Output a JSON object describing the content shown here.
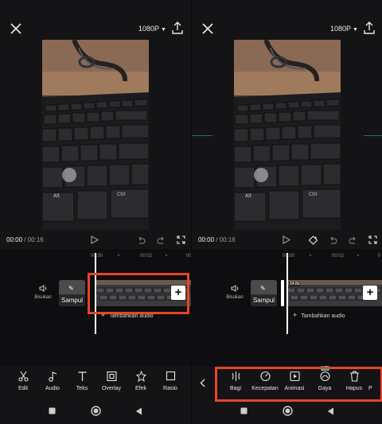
{
  "left": {
    "resolution": "1080P",
    "time_current": "00:00",
    "time_total": "/ 00:16",
    "ruler": [
      "00:00",
      "00:02",
      "00"
    ],
    "mute_label": "Bisukan",
    "cover_label": "Sampul",
    "add_audio_label": "Tambahkan audio",
    "tools": [
      {
        "label": "Edit",
        "icon": "scissors-icon"
      },
      {
        "label": "Audio",
        "icon": "music-note-icon"
      },
      {
        "label": "Teks",
        "icon": "text-icon"
      },
      {
        "label": "Overlay",
        "icon": "overlay-icon"
      },
      {
        "label": "Efek",
        "icon": "effects-star-icon"
      },
      {
        "label": "Rasio",
        "icon": "ratio-square-icon"
      }
    ]
  },
  "right": {
    "resolution": "1080P",
    "time_current": "00:00",
    "time_total": "/ 00:16",
    "ruler": [
      "00:00",
      "00:02",
      "0"
    ],
    "mute_label": "Bisukan",
    "cover_label": "Sampul",
    "clip_duration": "14.8s",
    "add_audio_label": "Tambahkan audio",
    "try_badge": "Try",
    "tools": [
      {
        "label": "Bagi",
        "icon": "split-icon"
      },
      {
        "label": "Kecepatan",
        "icon": "speed-gauge-icon"
      },
      {
        "label": "Animasi",
        "icon": "animation-play-icon"
      },
      {
        "label": "Gaya",
        "icon": "style-icon"
      },
      {
        "label": "Hapus",
        "icon": "trash-icon"
      },
      {
        "label": "P",
        "icon": "truncated-tool"
      }
    ]
  },
  "colors": {
    "highlight": "#e8442a",
    "background": "#141416",
    "guide": "#1e6f72",
    "try_badge": "#35c6b9"
  }
}
